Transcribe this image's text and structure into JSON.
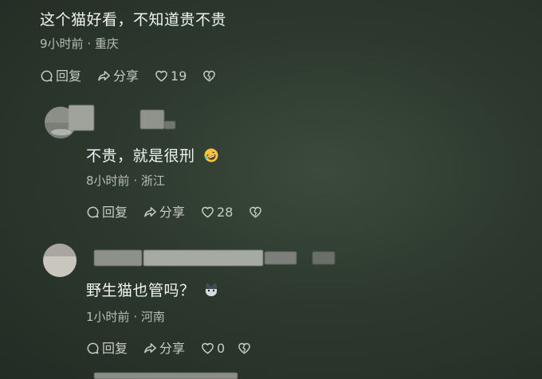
{
  "comments": [
    {
      "text": "这个猫好看，不知道贵不贵",
      "time": "9小时前",
      "dot": "·",
      "location": "重庆",
      "reply_label": "回复",
      "share_label": "分享",
      "likes": "19"
    },
    {
      "text": "不贵，就是很刑",
      "emoji_icon": "rofl-icon",
      "time": "8小时前",
      "dot": "·",
      "location": "浙江",
      "reply_label": "回复",
      "share_label": "分享",
      "likes": "28"
    },
    {
      "text": "野生猫也管吗？",
      "emoji_icon": "cat-face-icon",
      "time": "1小时前",
      "dot": "·",
      "location": "河南",
      "reply_label": "回复",
      "share_label": "分享",
      "likes": "0"
    }
  ],
  "colors": {
    "background": "#2d392e",
    "text": "#f2f3f0",
    "meta": "#b8beb6",
    "icon": "#c7ccc4"
  }
}
